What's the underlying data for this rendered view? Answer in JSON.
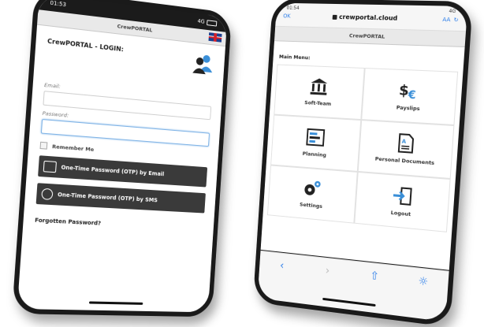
{
  "left_phone": {
    "status_time": "01:53",
    "status_right": "4G",
    "app_title": "CrewPORTAL",
    "login_title": "CrewPORTAL - LOGIN:",
    "email_label": "Email:",
    "password_label": "Password:",
    "remember_label": "Remember Me",
    "otp_email_label": "One-Time Password (OTP) by Email",
    "otp_sms_label": "One-Time Password (OTP) by SMS",
    "forgot_label": "Forgotten Password?",
    "flag_icon": "uk-flag-icon",
    "user_icon": "users-icon"
  },
  "right_phone": {
    "status_time": "01:54",
    "status_right": "4G",
    "ok_label": "OK",
    "url": "crewportal.cloud",
    "aa_label": "AA",
    "app_title": "CrewPORTAL",
    "menu_title": "Main Menu:",
    "menu": [
      {
        "label": "Soft-Team",
        "icon": "bank-icon"
      },
      {
        "label": "Payslips",
        "icon": "money-icon"
      },
      {
        "label": "Planning",
        "icon": "planning-icon"
      },
      {
        "label": "Personal Documents",
        "icon": "document-icon"
      },
      {
        "label": "Settings",
        "icon": "gear-icon"
      },
      {
        "label": "Logout",
        "icon": "logout-icon"
      }
    ],
    "colors": {
      "accent": "#2b7de9"
    }
  }
}
